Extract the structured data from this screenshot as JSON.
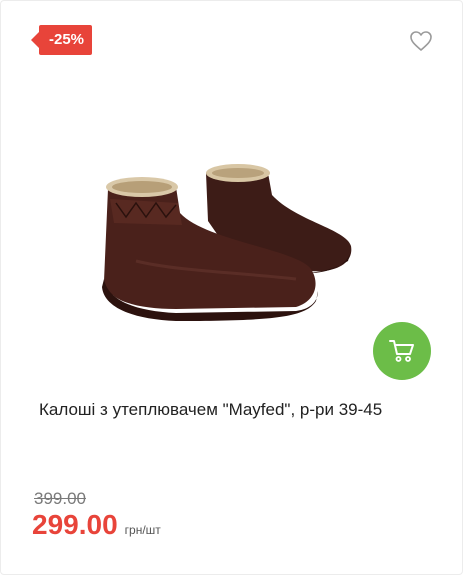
{
  "badge": {
    "discount": "-25%"
  },
  "favorite": {
    "icon": "heart-icon"
  },
  "product": {
    "title": "Калоші з утеплювачем \"Mayfed\", р-ри 39-45",
    "image_icon": "boots-image"
  },
  "cart": {
    "icon": "cart-icon",
    "color": "#6cbd48"
  },
  "price": {
    "old": "399.00",
    "current": "299.00",
    "unit": "грн/шт",
    "accent": "#e8443a"
  }
}
